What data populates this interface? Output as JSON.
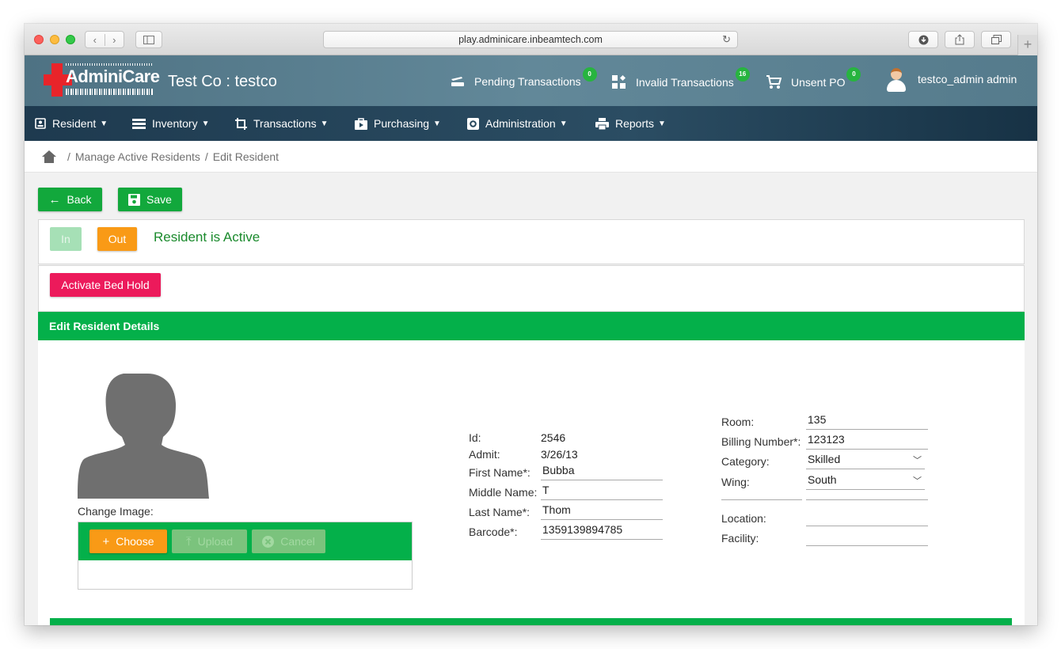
{
  "browser": {
    "url": "play.adminicare.inbeamtech.com",
    "back_icon": "chevron-left-icon",
    "forward_icon": "chevron-right-icon"
  },
  "header": {
    "logo_text": "AdminiCare",
    "company": "Test Co : testco",
    "pending": {
      "label": "Pending Transactions",
      "count": "0"
    },
    "invalid": {
      "label": "Invalid Transactions",
      "count": "16"
    },
    "unsent": {
      "label": "Unsent PO",
      "count": "0"
    },
    "user": "testco_admin admin",
    "badge_color": "#27b43f"
  },
  "nav": {
    "resident": "Resident",
    "inventory": "Inventory",
    "transactions": "Transactions",
    "purchasing": "Purchasing",
    "administration": "Administration",
    "reports": "Reports"
  },
  "breadcrumb": {
    "sep": "/",
    "level1": "Manage Active Residents",
    "level2": "Edit Resident"
  },
  "actions": {
    "back": "Back",
    "save": "Save",
    "in": "In",
    "out": "Out",
    "status": "Resident is Active",
    "bed_hold": "Activate Bed Hold"
  },
  "details": {
    "title": "Edit Resident Details",
    "change_image": "Change Image:",
    "choose": "Choose",
    "upload": "Upload",
    "cancel": "Cancel"
  },
  "fields": {
    "id": {
      "label": "Id:",
      "value": "2546"
    },
    "admit": {
      "label": "Admit:",
      "value": "3/26/13"
    },
    "first_name": {
      "label": "First Name*:",
      "value": "Bubba"
    },
    "middle_name": {
      "label": "Middle Name:",
      "value": "T"
    },
    "last_name": {
      "label": "Last Name*:",
      "value": "Thom"
    },
    "barcode": {
      "label": "Barcode*:",
      "value": "1359139894785"
    },
    "room": {
      "label": "Room:",
      "value": "135"
    },
    "billing_number": {
      "label": "Billing Number*:",
      "value": "123123"
    },
    "category": {
      "label": "Category:",
      "value": "Skilled"
    },
    "wing": {
      "label": "Wing:",
      "value": "South"
    },
    "location": {
      "label": "Location:",
      "value": ""
    },
    "facility": {
      "label": "Facility:",
      "value": ""
    }
  },
  "colors": {
    "green": "#04b04a",
    "orange": "#f99a16",
    "pink": "#ec1a5b",
    "header_teal": "#5a8091",
    "nav_dark": "#1e3a4f"
  }
}
